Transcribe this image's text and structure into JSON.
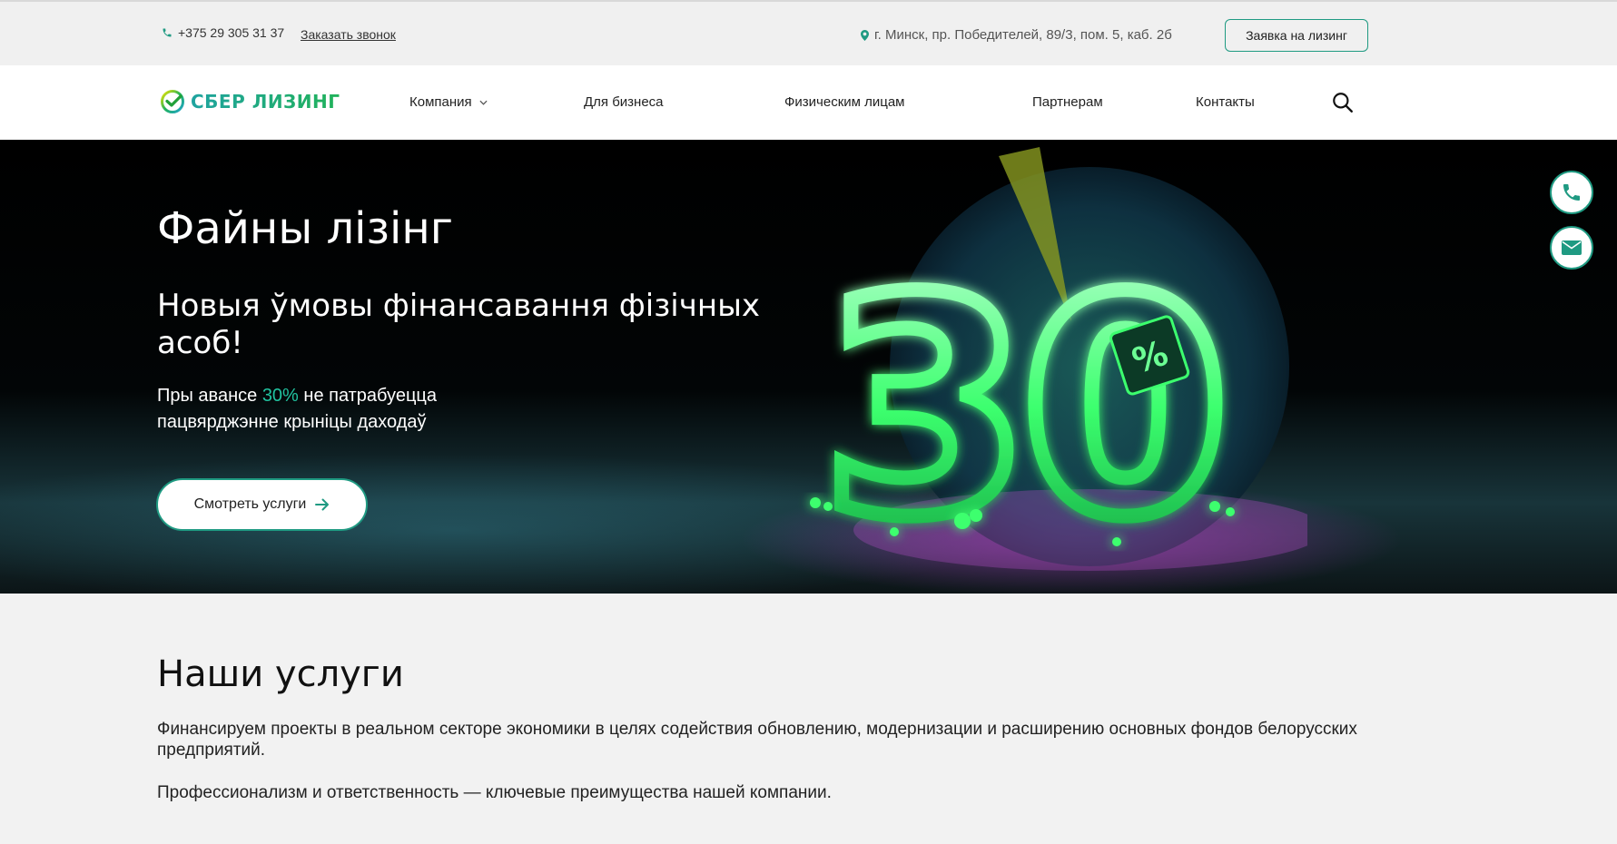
{
  "topbar": {
    "phone": "+375 29 305 31 37",
    "callback_label": "Заказать звонок",
    "address": "г. Минск, пр. Победителей, 89/3, пом. 5, каб. 2б",
    "lease_button": "Заявка на лизинг"
  },
  "nav": {
    "logo": "СБЕР ЛИЗИНГ",
    "items": [
      "Компания",
      "Для бизнеса",
      "Физическим лицам",
      "Партнерам",
      "Контакты"
    ]
  },
  "hero": {
    "title": "Файны лізінг",
    "subtitle": "Новыя ўмовы фінансавання фізічных асоб!",
    "text_before": "Пры авансе ",
    "text_accent": "30%",
    "text_after": " не патрабуецца пацвярджэнне крыніцы даходаў",
    "cta_label": "Смотреть услуги",
    "art_number": "30",
    "art_tag": "%"
  },
  "services": {
    "title": "Наши услуги",
    "paragraph1": "Финансируем проекты в реальном секторе экономики в целях содействия обновлению, модернизации и расширению основных фондов белорусских предприятий.",
    "paragraph2": "Профессионализм и ответственность — ключевые преимущества нашей компании."
  },
  "colors": {
    "accent": "#1f9a82",
    "brand_green": "#21b25a",
    "highlight": "#21c3a0"
  },
  "icons": [
    "phone-icon",
    "location-pin-icon",
    "chevron-down-icon",
    "search-icon",
    "arrow-right-icon",
    "mail-icon",
    "sber-logo-icon"
  ]
}
